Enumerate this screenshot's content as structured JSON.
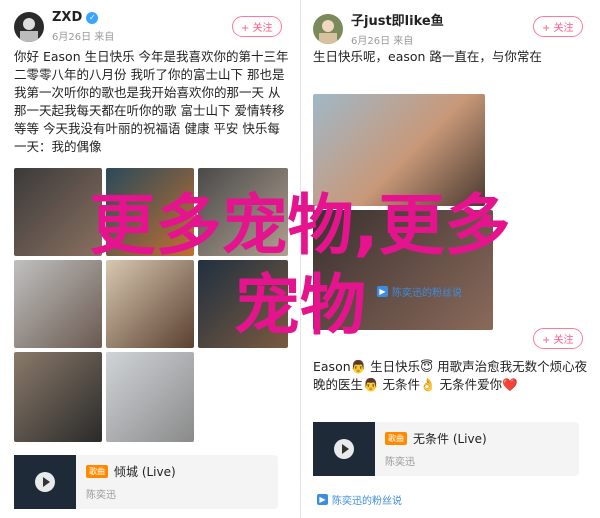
{
  "left": {
    "post1": {
      "username": "ZXD",
      "time": "6月26日 来自",
      "follow_label": "+ 关注",
      "text": "你好 Eason 生日快乐 今年是我喜欢你的第十三年二零零八年的八月份 我听了你的富士山下 那也是我第一次听你的歌也是我开始喜欢你的那一天 从那一天起我每天都在听你的歌 富士山下 爱情转移 等等 今天我没有叶丽的祝福语 健康 平安 快乐每一天：我的偶像"
    },
    "music1": {
      "badge": "歌曲",
      "title": "倾城 (Live)",
      "artist": "陈奕迅"
    }
  },
  "right": {
    "post1": {
      "username": "子just即like鱼",
      "time": "6月26日 来自",
      "follow_label": "+ 关注",
      "tag": "生日快乐呢",
      "text": "生日快乐呢，eason 路一直在，与你常在"
    },
    "post2": {
      "follow_label": "+ 关注",
      "text": "Eason👨 生日快乐😇 用歌声治愈我无数个烦心夜晚的医生👨 无条件👌 无条件爱你❤️"
    },
    "music2": {
      "badge": "歌曲",
      "title": "无条件 (Live)",
      "artist": "陈奕迅"
    },
    "repost_label": "陈奕迅的粉丝说",
    "repost_label2": "陈奕迅的粉丝说"
  },
  "overlay": {
    "line1": "更多宠物,更多",
    "line2": "宠物"
  },
  "colors": {
    "overlay": "#e5138e",
    "link": "#3c8dde",
    "follow": "#ff5a82"
  }
}
